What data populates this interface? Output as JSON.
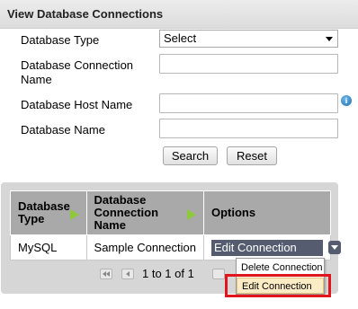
{
  "header": {
    "title": "View Database Connections"
  },
  "form": {
    "db_type_label": "Database Type",
    "db_type_value": "Select",
    "conn_name_label_1": "Database Connection",
    "conn_name_label_2": "Name",
    "host_label": "Database Host Name",
    "db_name_label": "Database Name",
    "info_icon_glyph": "i"
  },
  "buttons": {
    "search": "Search",
    "reset": "Reset"
  },
  "grid": {
    "headers": {
      "db_type_1": "Database",
      "db_type_2": "Type",
      "conn_name_1": "Database",
      "conn_name_2": "Connection",
      "conn_name_3": "Name",
      "options": "Options"
    },
    "rows": [
      {
        "db_type": "MySQL",
        "conn_name": "Sample Connection",
        "option_selected": "Edit Connection"
      }
    ]
  },
  "pager": {
    "text": "1 to 1 of 1"
  },
  "options_menu": {
    "items": [
      "Delete Connection",
      "Edit Connection"
    ],
    "highlighted": "Edit Connection"
  },
  "colors": {
    "header_bg": "#a9a9a9",
    "sort_arrow": "#8fc83a",
    "option_select_bg": "#555c70",
    "highlight_box": "#e0161c",
    "menu_selected_bg": "#fbecc6"
  }
}
